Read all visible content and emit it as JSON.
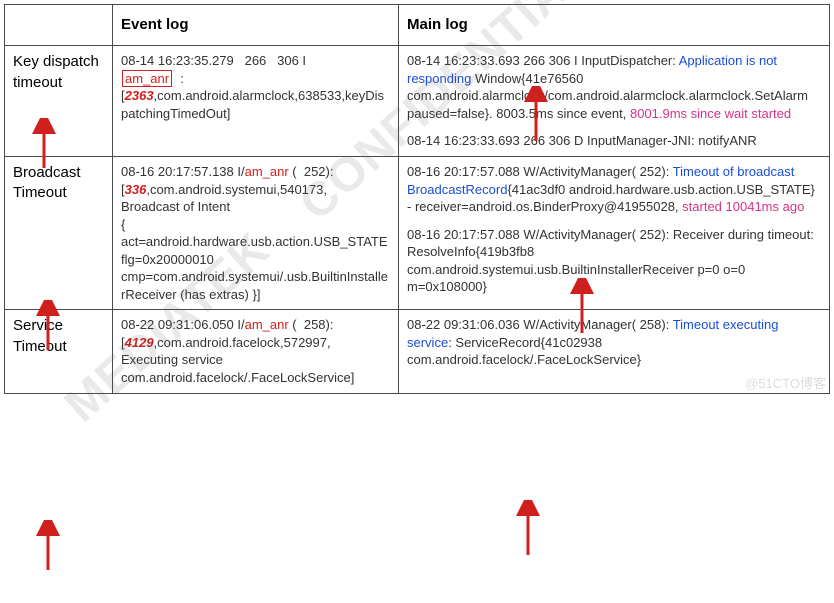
{
  "headers": {
    "col0": "",
    "col1": "Event log",
    "col2": "Main log"
  },
  "rows": [
    {
      "label": "Key dispatch timeout",
      "event": {
        "prefix": "08-14 16:23:35.279   266   306 I\n",
        "tag": "am_anr",
        "sep": "  :\n[",
        "pid": "2363",
        "rest": ",com.android.alarmclock,638533,keyDispatchingTimedOut]"
      },
      "main": {
        "l1": "08-14 16:23:33.693   266   306 I InputDispatcher: ",
        "blue1": "Application is not responding",
        "l2": "  Window{41e76560 com.android.alarmclock/com.android.alarmclock.alarmclock.SetAlarm paused=false}.  8003.5ms since event, ",
        "pink1": "8001.9ms since wait started",
        "l3": "08-14 16:23:33.693   266   306 D InputManager-JNI: notifyANR"
      }
    },
    {
      "label": "Broadcast Timeout",
      "event": {
        "prefix": "08-16 20:17:57.138 I/",
        "tag": "am_anr",
        "sep": " (  252):\n[",
        "pid": "336",
        "rest": ",com.android.systemui,540173,\nBroadcast of Intent\n{ act=android.hardware.usb.action.USB_STATE flg=0x20000010 cmp=com.android.systemui/.usb.BuiltinInstallerReceiver (has extras) }]"
      },
      "main": {
        "l1": "08-16 20:17:57.088 W/ActivityManager(  252): ",
        "blue1": "Timeout of broadcast BroadcastRecord",
        "l2": "{41ac3df0 android.hardware.usb.action.USB_STATE} - receiver=android.os.BinderProxy@41955028, ",
        "pink1": "started 10041ms ago",
        "l3": "08-16 20:17:57.088 W/ActivityManager(  252): Receiver during timeout: ResolveInfo{419b3fb8 com.android.systemui.usb.BuiltinInstallerReceiver p=0 o=0 m=0x108000}"
      }
    },
    {
      "label": "Service Timeout",
      "event": {
        "prefix": "08-22 09:31:06.050 I/",
        "tag": "am_anr",
        "sep": " (  258):\n[",
        "pid": "4129",
        "rest": ",com.android.facelock,572997,\nExecuting service com.android.facelock/.FaceLockService]"
      },
      "main": {
        "l1": "08-22 09:31:06.036 W/ActivityManager(  258): ",
        "blue1": "Timeout executing service",
        "l2": ": ServiceRecord{41c02938 com.android.facelock/.FaceLockService}",
        "pink1": "",
        "l3": ""
      }
    }
  ],
  "watermarks": {
    "wm1": "CONFIDENTIAL",
    "wm2": "MEDIATEK",
    "brand": "@51CTO博客"
  }
}
